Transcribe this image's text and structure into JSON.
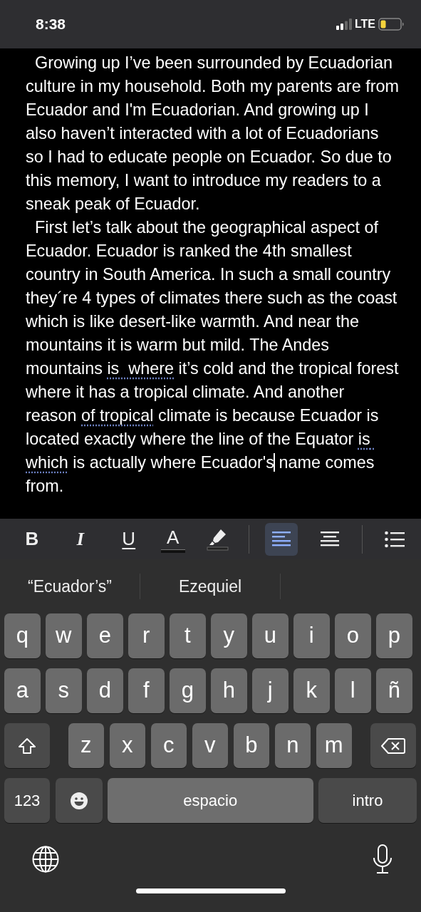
{
  "status_bar": {
    "time": "8:38",
    "network": "LTE"
  },
  "document": {
    "paragraphs": [
      {
        "segments": [
          {
            "kind": "plain",
            "text": "  Growing up I’ve been surrounded by Ecuadorian culture in my household. Both my parents are from Ecuador and I'm Ecuadorian. And growing up I also haven’t interacted with a lot of Ecuadorians so I had to educate people on Ecuador. So due to this memory, I want to introduce my readers to a sneak peak of Ecuador."
          }
        ]
      },
      {
        "segments": [
          {
            "kind": "plain",
            "text": "  First let’s talk about the geographical aspect of Ecuador. Ecuador is ranked the 4th smallest country in South America. In such a small country they´re 4 types of climates there such as the coast which is like desert-like warmth. And near the mountains it is warm but mild. The Andes mountains "
          },
          {
            "kind": "flagged",
            "text": "is  where"
          },
          {
            "kind": "plain",
            "text": " it’s cold and the tropical forest where it has a tropical climate. And another reason "
          },
          {
            "kind": "flagged",
            "text": "of tropical"
          },
          {
            "kind": "plain",
            "text": " climate is because Ecuador is located exactly where the line of the Equator "
          },
          {
            "kind": "flagged",
            "text": "is which"
          },
          {
            "kind": "plain",
            "text": " is actually where Ecuador's"
          },
          {
            "kind": "caret"
          },
          {
            "kind": "plain",
            "text": " name comes from."
          }
        ]
      }
    ]
  },
  "toolbar": {
    "items": [
      {
        "kind": "bold",
        "label": "B",
        "selected": false
      },
      {
        "kind": "italic",
        "label": "I",
        "selected": false
      },
      {
        "kind": "underline",
        "label": "U",
        "selected": false
      },
      {
        "kind": "text_color",
        "label": "A",
        "selected": false
      },
      {
        "kind": "highlight",
        "selected": false
      },
      {
        "kind": "align_left",
        "selected": true
      },
      {
        "kind": "align_center",
        "selected": false
      },
      {
        "kind": "list",
        "selected": false
      }
    ]
  },
  "suggestions": [
    "“Ecuador’s”",
    "Ezequiel"
  ],
  "keyboard": {
    "rows": [
      {
        "keys": [
          {
            "kind": "letter",
            "label": "q"
          },
          {
            "kind": "letter",
            "label": "w"
          },
          {
            "kind": "letter",
            "label": "e"
          },
          {
            "kind": "letter",
            "label": "r"
          },
          {
            "kind": "letter",
            "label": "t"
          },
          {
            "kind": "letter",
            "label": "y"
          },
          {
            "kind": "letter",
            "label": "u"
          },
          {
            "kind": "letter",
            "label": "i"
          },
          {
            "kind": "letter",
            "label": "o"
          },
          {
            "kind": "letter",
            "label": "p"
          }
        ]
      },
      {
        "keys": [
          {
            "kind": "letter",
            "label": "a"
          },
          {
            "kind": "letter",
            "label": "s"
          },
          {
            "kind": "letter",
            "label": "d"
          },
          {
            "kind": "letter",
            "label": "f"
          },
          {
            "kind": "letter",
            "label": "g"
          },
          {
            "kind": "letter",
            "label": "h"
          },
          {
            "kind": "letter",
            "label": "j"
          },
          {
            "kind": "letter",
            "label": "k"
          },
          {
            "kind": "letter",
            "label": "l"
          },
          {
            "kind": "letter",
            "label": "ñ"
          }
        ]
      },
      {
        "keys": [
          {
            "kind": "shift"
          },
          {
            "kind": "letter",
            "label": "z"
          },
          {
            "kind": "letter",
            "label": "x"
          },
          {
            "kind": "letter",
            "label": "c"
          },
          {
            "kind": "letter",
            "label": "v"
          },
          {
            "kind": "letter",
            "label": "b"
          },
          {
            "kind": "letter",
            "label": "n"
          },
          {
            "kind": "letter",
            "label": "m"
          },
          {
            "kind": "backspace"
          }
        ]
      },
      {
        "keys": [
          {
            "kind": "numbers",
            "label": "123"
          },
          {
            "kind": "emoji"
          },
          {
            "kind": "space",
            "label": "espacio"
          },
          {
            "kind": "return",
            "label": "intro"
          }
        ]
      }
    ]
  }
}
